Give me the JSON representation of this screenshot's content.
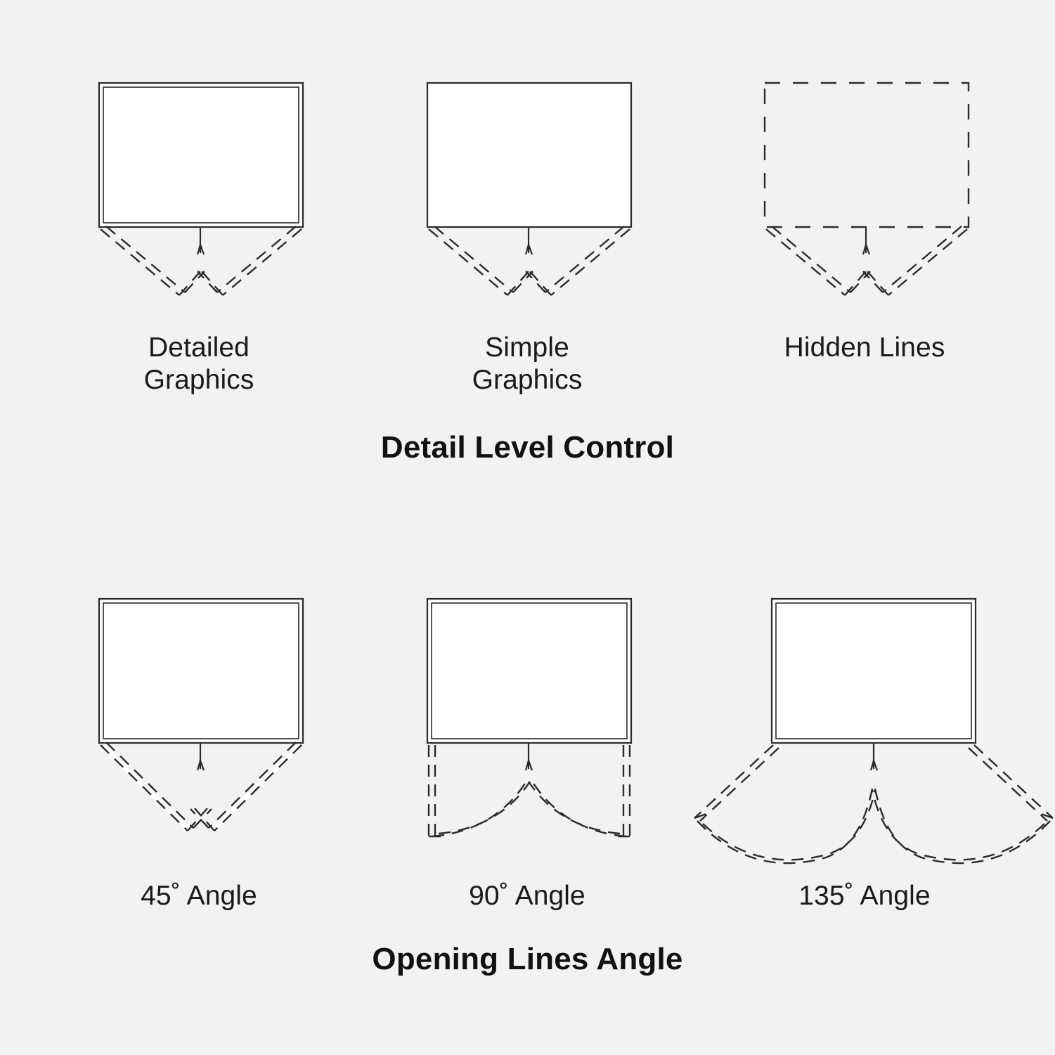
{
  "background_color": "#f2f2f2",
  "line_color": "#2b2b2b",
  "fill_color": "#ffffff",
  "text_color": "#1a1a1a",
  "sections": [
    {
      "id": "detail-level-control",
      "title": "Detail Level Control",
      "panels": [
        {
          "id": "detailed-graphics",
          "caption_line1": "Detailed",
          "caption_line2": "Graphics",
          "frame_style": "double-line",
          "filled": true,
          "opening_style": "45-degree"
        },
        {
          "id": "simple-graphics",
          "caption_line1": "Simple",
          "caption_line2": "Graphics",
          "frame_style": "single-line",
          "filled": true,
          "opening_style": "45-degree"
        },
        {
          "id": "hidden-lines",
          "caption_line1": "Hidden Lines",
          "caption_line2": "",
          "frame_style": "dashed",
          "filled": false,
          "opening_style": "45-degree"
        }
      ]
    },
    {
      "id": "opening-lines-angle",
      "title": "Opening Lines Angle",
      "panels": [
        {
          "id": "angle-45",
          "caption_line1": "45˚ Angle",
          "caption_line2": "",
          "frame_style": "double-line",
          "filled": true,
          "opening_style": "45-degree",
          "angle_value": 45
        },
        {
          "id": "angle-90",
          "caption_line1": "90˚ Angle",
          "caption_line2": "",
          "frame_style": "double-line",
          "filled": true,
          "opening_style": "90-degree",
          "angle_value": 90
        },
        {
          "id": "angle-135",
          "caption_line1": "135˚ Angle",
          "caption_line2": "",
          "frame_style": "double-line",
          "filled": true,
          "opening_style": "135-degree",
          "angle_value": 135
        }
      ]
    }
  ]
}
